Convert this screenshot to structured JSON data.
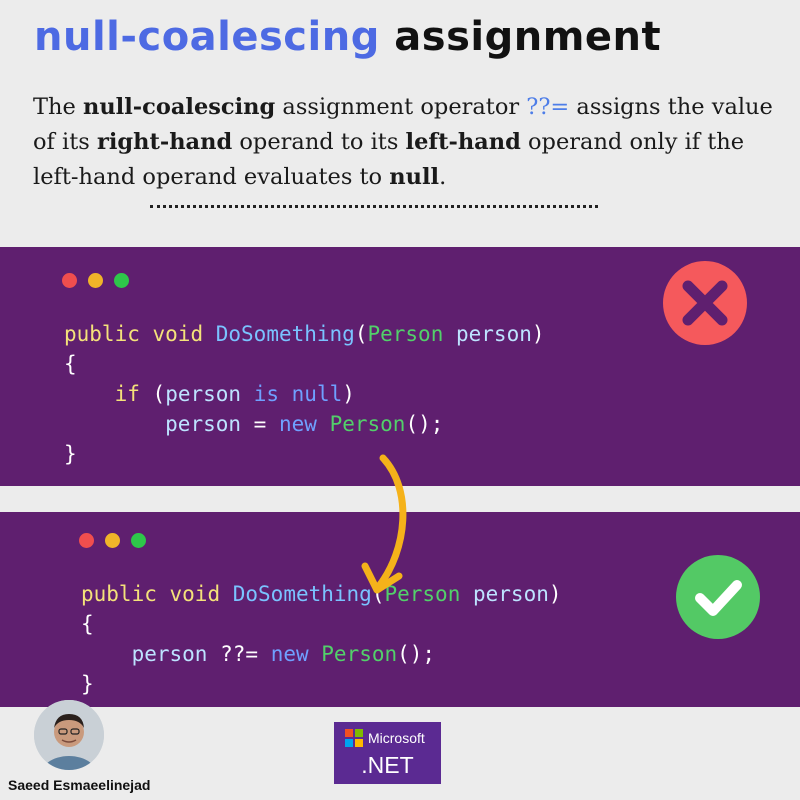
{
  "header": {
    "title_highlight": "null-coalescing",
    "title_rest": "assignment"
  },
  "description": {
    "p1": "The ",
    "b1": "null-coalescing",
    "p2": " assignment operator ",
    "operator": "??=",
    "p3": " assigns the value of its ",
    "b2": "right-hand",
    "p4": " operand to its ",
    "b3": "left-hand",
    "p5": " operand only if the left-hand operand evaluates to ",
    "b4": "null",
    "p6": "."
  },
  "bad_example": {
    "status_icon": "cross-icon",
    "status_color": "#f5595c",
    "line1": {
      "kw1": "public",
      "kw2": "void",
      "fn": "DoSomething",
      "open": "(",
      "type": "Person",
      "param": "person",
      "close": ")"
    },
    "line2": "{",
    "line3": {
      "kw": "if",
      "open": "(",
      "var": "person",
      "op": "is",
      "lit": "null",
      "close": ")"
    },
    "line4": {
      "var": "person",
      "eq": "=",
      "new": "new",
      "type": "Person",
      "end": "();"
    },
    "line5": "}"
  },
  "good_example": {
    "status_icon": "check-icon",
    "status_color": "#53c965",
    "line1": {
      "kw1": "public",
      "kw2": "void",
      "fn": "DoSomething",
      "open": "(",
      "type": "Person",
      "param": "person",
      "close": ")"
    },
    "line2": "{",
    "line3": {
      "var": "person",
      "op": "??=",
      "new": "new",
      "type": "Person",
      "end": "();"
    },
    "line4": "}"
  },
  "footer": {
    "author": "Saeed Esmaeelinejad",
    "brand_company": "Microsoft",
    "brand_product": ".NET"
  },
  "colors": {
    "title_accent": "#4d6ae3",
    "panel_bg": "#5f1f6f",
    "arrow": "#f5b21a"
  }
}
